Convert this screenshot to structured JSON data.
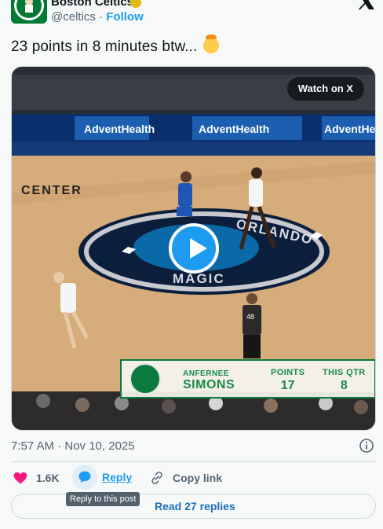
{
  "header": {
    "account_name": "Boston Celtics",
    "handle": "@celtics",
    "separator": " · ",
    "follow_label": "Follow"
  },
  "tweet": {
    "text": "23 points in 8 minutes btw..."
  },
  "media": {
    "watch_label": "Watch on X",
    "overlay": {
      "player_first": "ANFERNEE",
      "player_last": "SIMONS",
      "points_label": "POINTS",
      "points_value": "17",
      "qtr_label": "THIS QTR",
      "qtr_value": "8"
    },
    "arena_signs": [
      "AdventHealth",
      "AdventHealth",
      "AdventHealth"
    ],
    "court_text_1": "ORLANDO",
    "court_text_2": "MAGIC",
    "sponsor": "CENTER",
    "referee_number": "48"
  },
  "meta": {
    "timestamp": "7:57 AM · Nov 10, 2025"
  },
  "actions": {
    "like_count": "1.6K",
    "reply_label": "Reply",
    "copy_link_label": "Copy link",
    "reply_tooltip": "Reply to this post"
  },
  "footer": {
    "read_replies_label": "Read 27 replies"
  },
  "colors": {
    "accent": "#1d9bf0",
    "like": "#f91880",
    "celtics_green": "#007a33"
  }
}
